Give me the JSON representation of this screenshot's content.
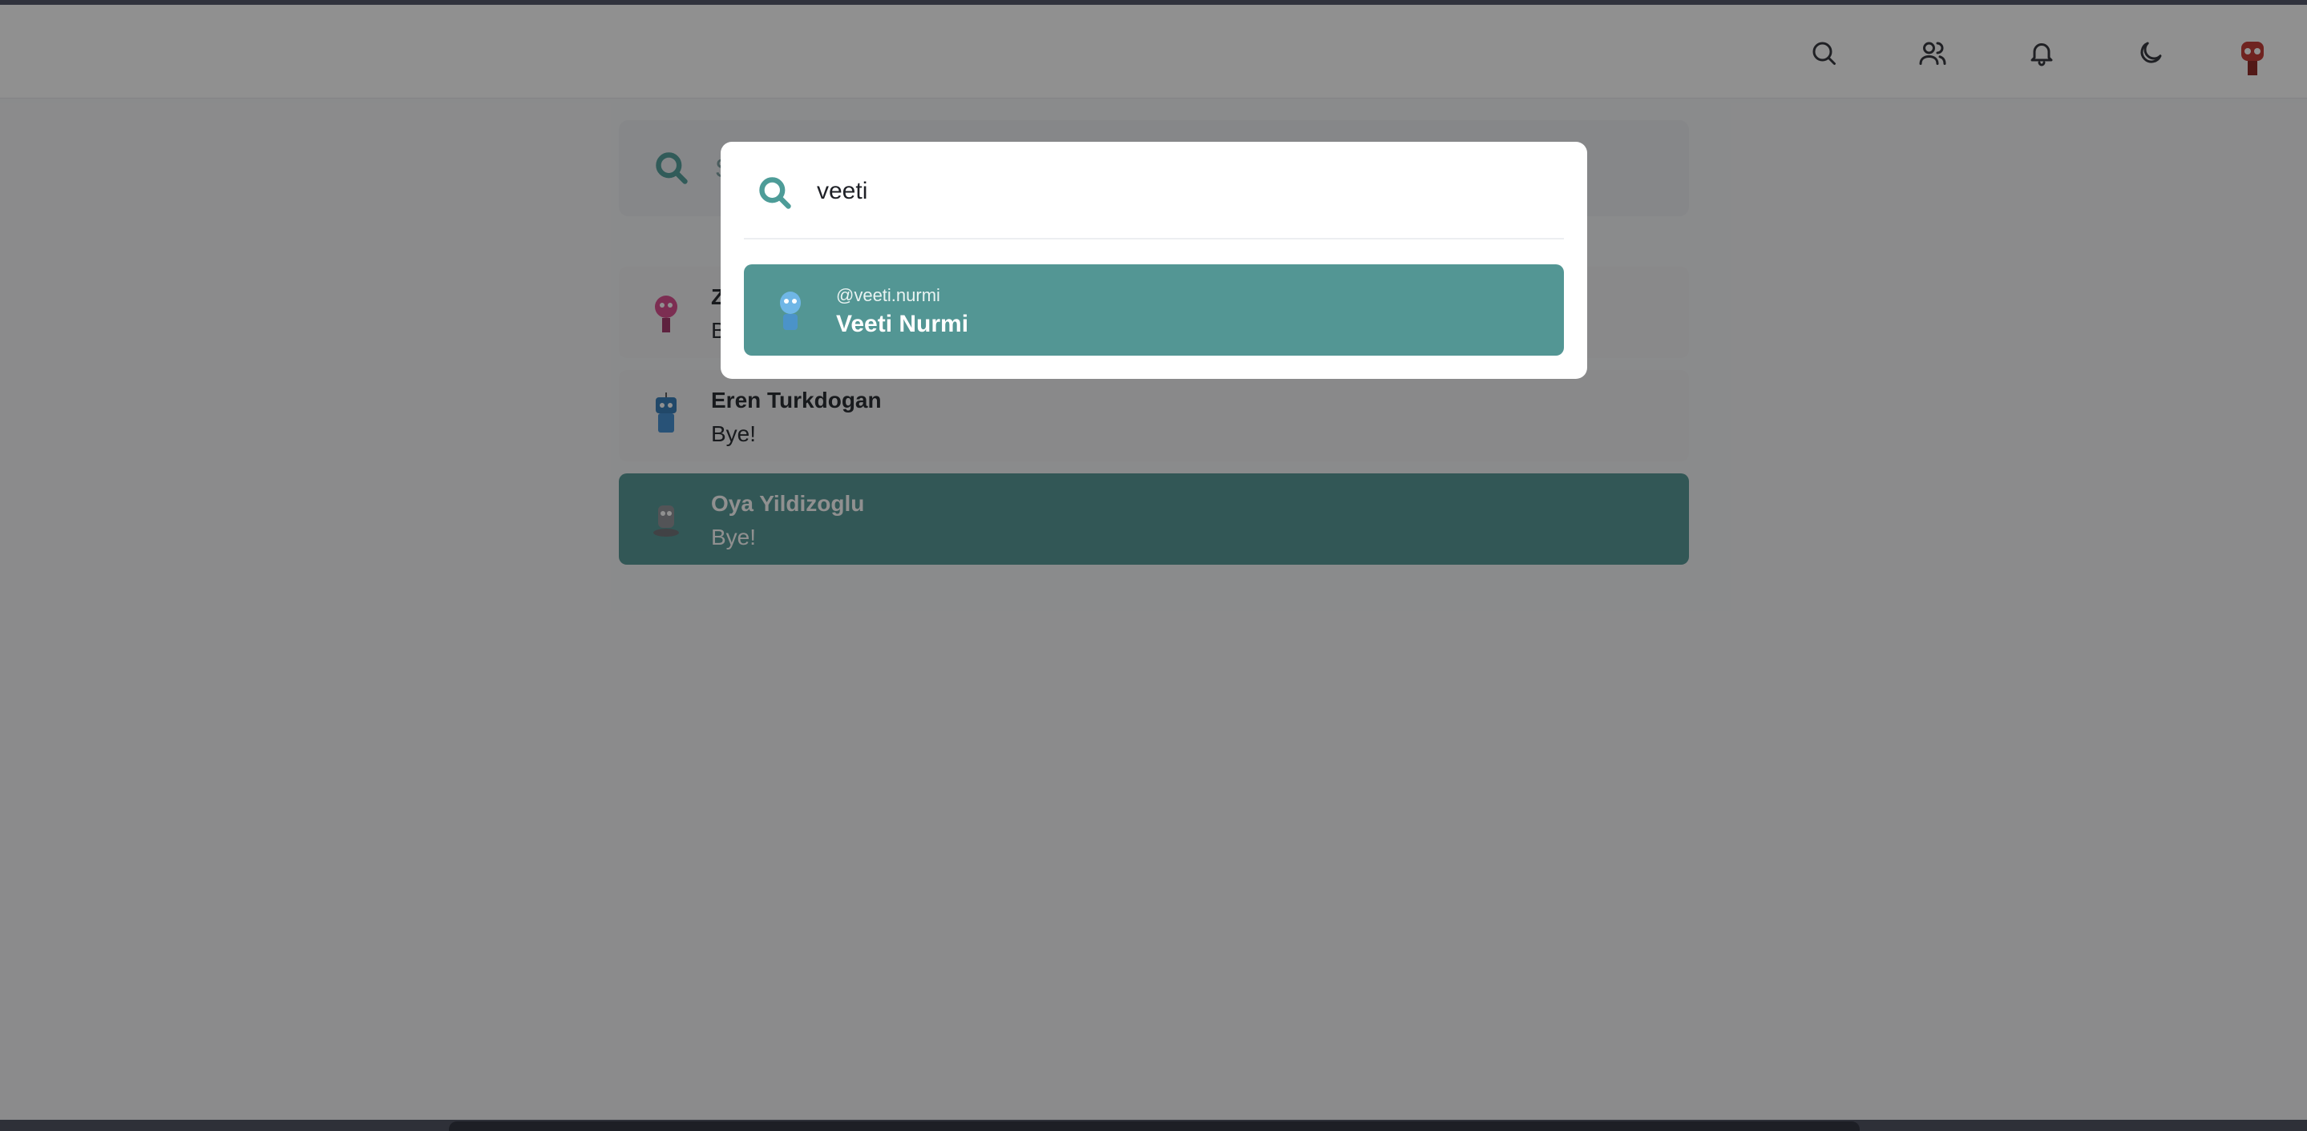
{
  "header": {
    "icons": [
      "search-icon",
      "users-icon",
      "bell-icon",
      "moon-icon",
      "profile-avatar"
    ]
  },
  "search": {
    "placeholder": "S"
  },
  "conversations": [
    {
      "name": "Z",
      "message": "B"
    },
    {
      "name": "Eren Turkdogan",
      "message": "Bye!"
    },
    {
      "name": "Oya Yildizoglu",
      "message": "Bye!",
      "active": true
    }
  ],
  "modal": {
    "query": "veeti",
    "results": [
      {
        "handle": "@veeti.nurmi",
        "name": "Veeti Nurmi"
      }
    ]
  },
  "colors": {
    "accent": "#539694",
    "active_row": "#4f9491",
    "overlay": "rgba(20,20,20,0.47)"
  }
}
